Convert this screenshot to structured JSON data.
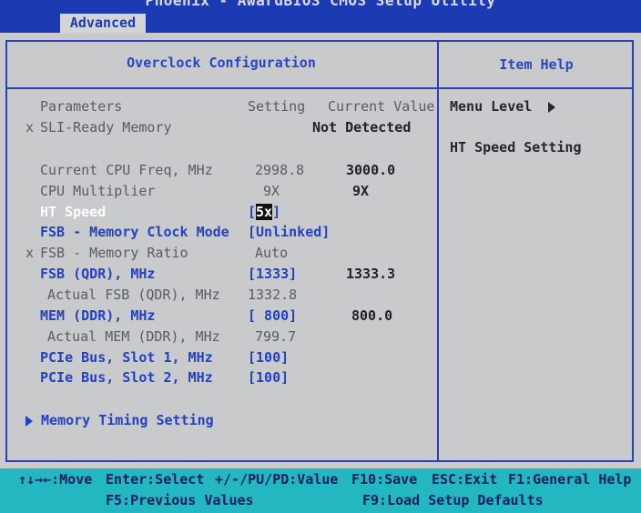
{
  "app": {
    "title": "Phoenix - AwardBIOS CMOS Setup Utility",
    "tab": "Advanced"
  },
  "panel": {
    "title": "Overclock Configuration",
    "help_title": "Item Help"
  },
  "columns": {
    "parameters": "Parameters",
    "setting": "Setting",
    "current": "Current Value"
  },
  "items": {
    "sli_ready": {
      "prefix": "x",
      "label": "SLI-Ready Memory",
      "current": "Not Detected"
    },
    "cpu_freq": {
      "label": "Current CPU Freq, MHz",
      "setting": "2998.8",
      "current": "3000.0"
    },
    "cpu_mult": {
      "label": "CPU Multiplier",
      "setting": "9X",
      "current": "9X"
    },
    "ht_speed": {
      "label": "HT Speed",
      "open": "[",
      "cursor": "5x",
      "close": "]"
    },
    "fsb_mode": {
      "label": "FSB - Memory Clock Mode",
      "setting": "[Unlinked]"
    },
    "fsb_ratio": {
      "prefix": "x",
      "label": "FSB - Memory Ratio",
      "setting": "Auto"
    },
    "fsb_qdr": {
      "label": "FSB (QDR), MHz",
      "setting": "[1333]",
      "current": "1333.3"
    },
    "actual_fsb": {
      "label": "Actual FSB (QDR), MHz",
      "setting": "1332.8"
    },
    "mem_ddr": {
      "label": "MEM (DDR), MHz",
      "setting": "[ 800]",
      "current": "800.0"
    },
    "actual_mem": {
      "label": "Actual MEM (DDR), MHz",
      "setting": "799.7"
    },
    "pcie1": {
      "label": "PCIe Bus, Slot 1, MHz",
      "setting": "[100]"
    },
    "pcie2": {
      "label": "PCIe Bus, Slot 2, MHz",
      "setting": "[100]"
    },
    "mem_timing": {
      "label": "Memory Timing Setting"
    }
  },
  "help": {
    "menu_level": "Menu Level",
    "description": "HT Speed Setting"
  },
  "footer": {
    "move": "↑↓→←:Move",
    "enter": "Enter:Select",
    "value": "+/-/PU/PD:Value",
    "save": "F10:Save",
    "exit": "ESC:Exit",
    "general_help": "F1:General Help",
    "prev_values": "F5:Previous Values",
    "load_defaults": "F9:Load Setup Defaults"
  }
}
